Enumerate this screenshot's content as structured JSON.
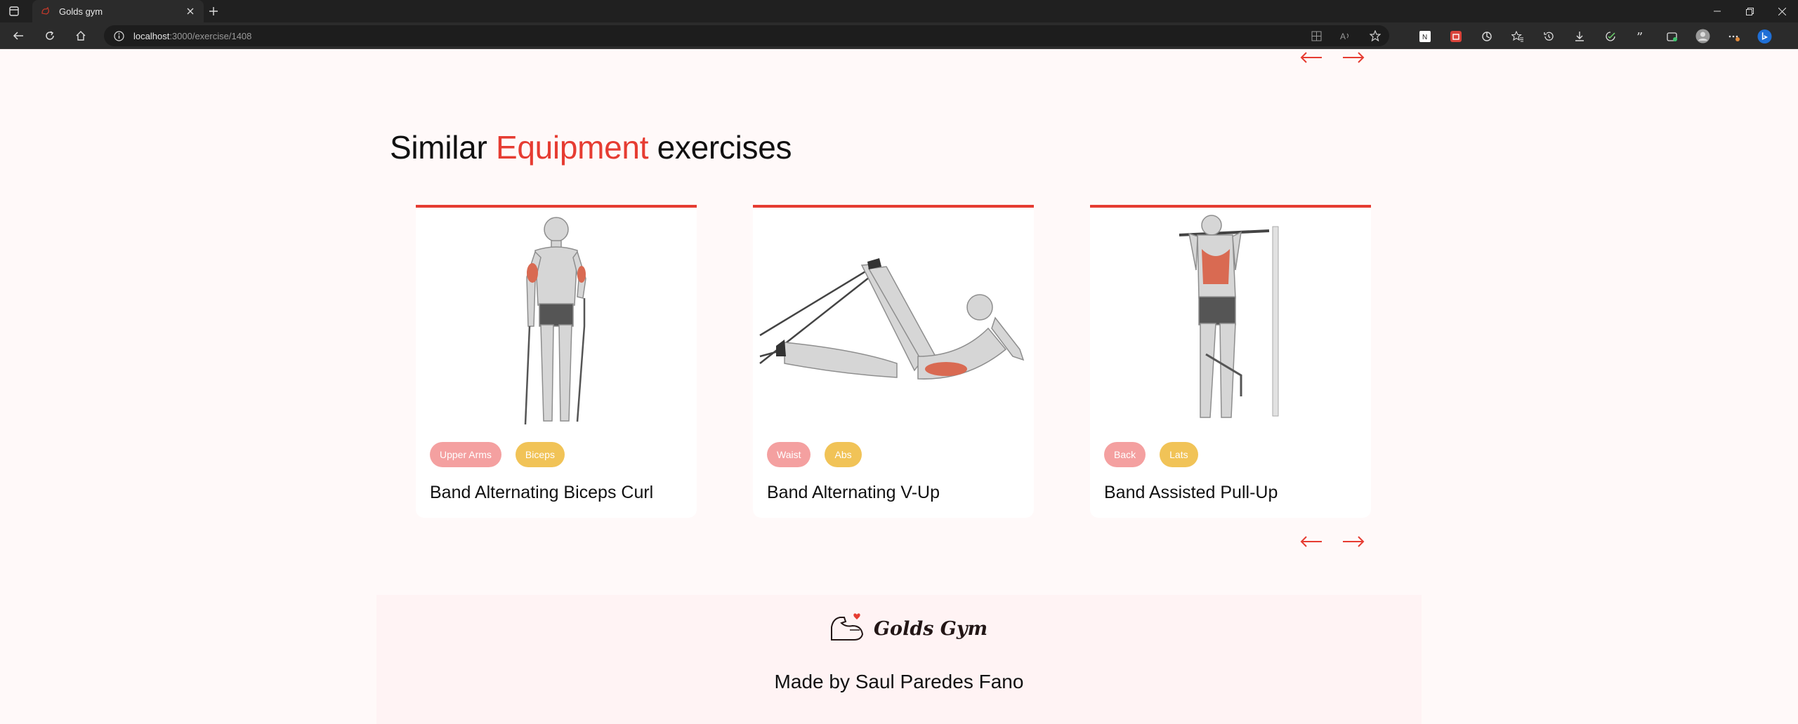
{
  "browser": {
    "tab_title": "Golds gym",
    "url_host": "localhost",
    "url_path": ":3000/exercise/1408",
    "icons": [
      "tab-actions-icon",
      "favicon-icon",
      "close-icon",
      "plus-icon",
      "back-icon",
      "refresh-icon",
      "home-icon",
      "info-icon",
      "split-screen-icon",
      "read-aloud-icon",
      "favorite-star-icon",
      "extension-icon",
      "favorites-icon",
      "history-icon",
      "downloads-icon",
      "shield-icon",
      "quote-icon",
      "wallet-icon",
      "profile-icon",
      "more-icon",
      "copilot-icon",
      "minimize-icon",
      "restore-icon",
      "close-window-icon"
    ]
  },
  "section": {
    "title_part1": "Similar ",
    "title_highlight": "Equipment",
    "title_part2": " exercises"
  },
  "colors": {
    "accent": "#e63c32",
    "muscle_pill": "#f4a0a0",
    "target_pill": "#f1c357",
    "page_bg": "#fff9f9",
    "footer_bg": "#fff3f4"
  },
  "cards": [
    {
      "name": "Band Alternating Biceps Curl",
      "body_part": "Upper Arms",
      "target": "Biceps"
    },
    {
      "name": "Band Alternating V-Up",
      "body_part": "Waist",
      "target": "Abs"
    },
    {
      "name": "Band Assisted Pull-Up",
      "body_part": "Back",
      "target": "Lats"
    }
  ],
  "footer": {
    "logo_text": "Golds Gym",
    "made_by": "Made by Saul Paredes Fano"
  }
}
